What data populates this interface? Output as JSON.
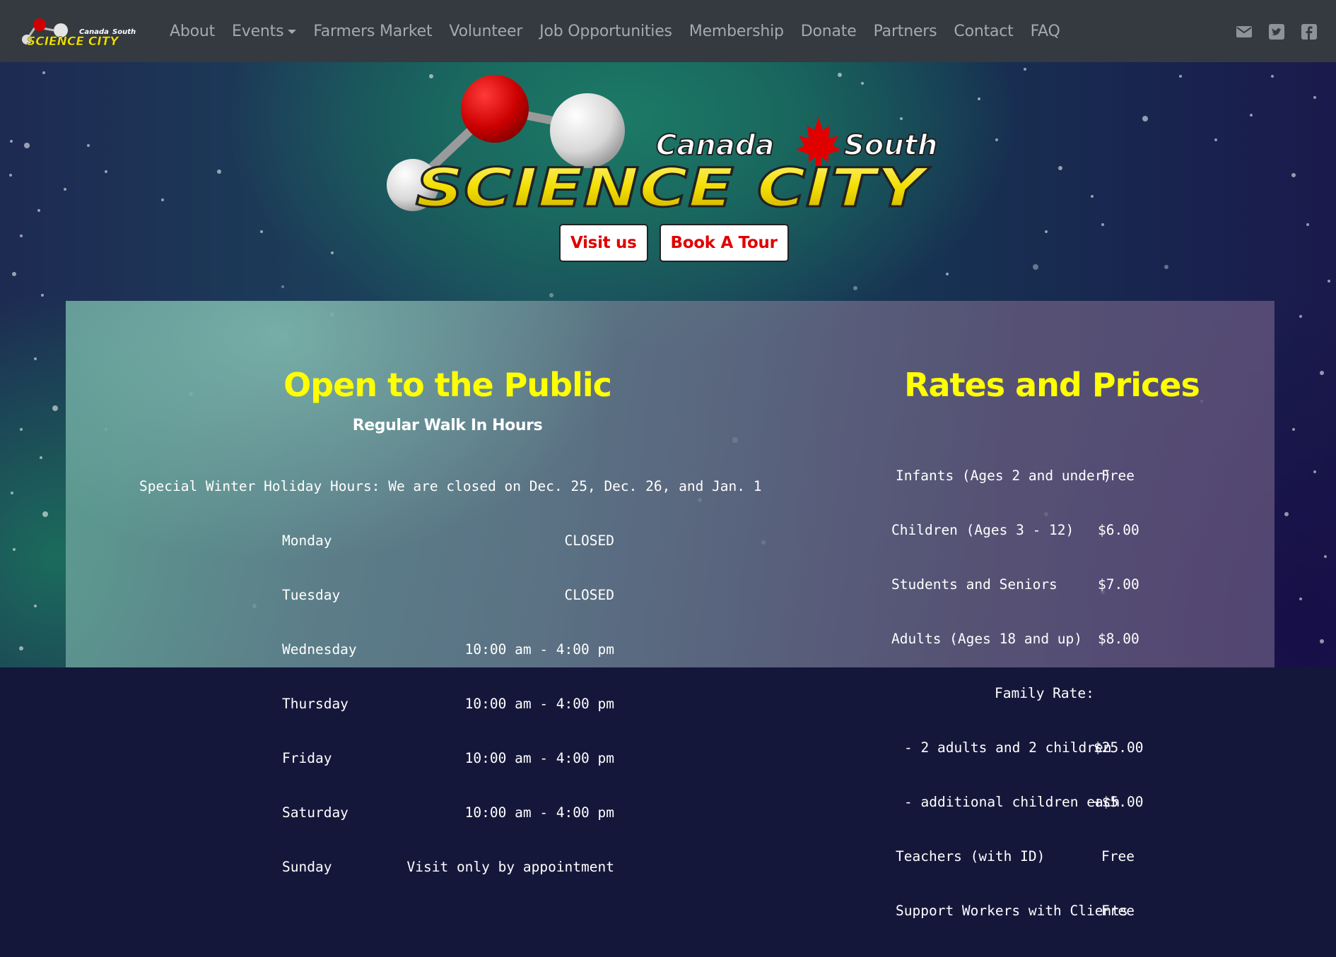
{
  "nav": {
    "brand_top": "Canada",
    "brand_top2": "South",
    "brand_main": "SCIENCE CITY",
    "items": [
      {
        "label": "About"
      },
      {
        "label": "Events"
      },
      {
        "label": "Farmers Market"
      },
      {
        "label": "Volunteer"
      },
      {
        "label": "Job Opportunities"
      },
      {
        "label": "Membership"
      },
      {
        "label": "Donate"
      },
      {
        "label": "Partners"
      },
      {
        "label": "Contact"
      },
      {
        "label": "FAQ"
      }
    ],
    "social": [
      "envelope-icon",
      "twitter-icon",
      "facebook-icon"
    ]
  },
  "hero": {
    "logo_top": "Canada",
    "logo_top2": "South",
    "logo_main": "SCIENCE CITY",
    "visit_label": "Visit us",
    "tour_label": "Book A Tour"
  },
  "hours": {
    "title": "Open to the Public",
    "subtitle": "Regular Walk In Hours",
    "holiday": "Special Winter Holiday Hours: We are closed on Dec. 25, Dec. 26, and Jan. 1",
    "rows": [
      {
        "day": "Monday",
        "time": "CLOSED"
      },
      {
        "day": "Tuesday",
        "time": "CLOSED"
      },
      {
        "day": "Wednesday",
        "time": "10:00 am - 4:00 pm"
      },
      {
        "day": "Thursday",
        "time": "10:00 am - 4:00 pm"
      },
      {
        "day": "Friday",
        "time": "10:00 am - 4:00 pm"
      },
      {
        "day": "Saturday",
        "time": "10:00 am - 4:00 pm"
      },
      {
        "day": "Sunday",
        "time": "Visit only by appointment"
      }
    ]
  },
  "rates": {
    "title": "Rates and Prices",
    "rows": [
      {
        "label": "Infants (Ages 2 and under)",
        "price": "Free"
      },
      {
        "label": "Children (Ages 3 - 12)",
        "price": "$6.00"
      },
      {
        "label": "Students and Seniors",
        "price": "$7.00"
      },
      {
        "label": "Adults (Ages 18 and up)",
        "price": "$8.00"
      },
      {
        "label": "Family Rate:",
        "price": ""
      },
      {
        "label": "- 2 adults and 2 children",
        "price": "$25.00"
      },
      {
        "label": "- additional children each",
        "price": "+$5.00"
      },
      {
        "label": "Teachers (with ID)",
        "price": "Free"
      },
      {
        "label": "Support Workers with Clients",
        "price": "Free"
      }
    ]
  },
  "colors": {
    "navbar": "#343a40",
    "nav_text": "#a6a9ad",
    "heading": "#ffff00",
    "button_text": "#e00000"
  }
}
